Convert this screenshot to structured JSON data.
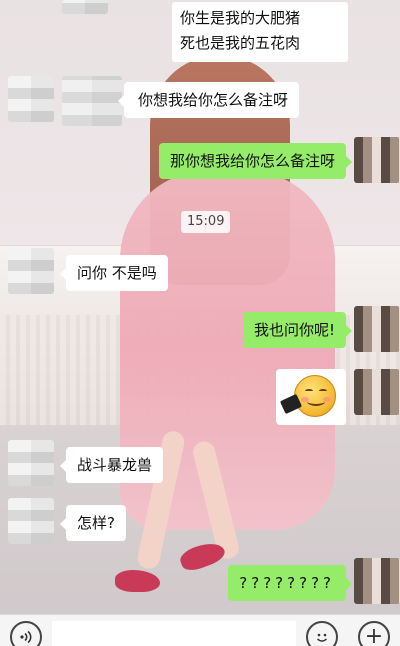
{
  "top_card": {
    "line1": "你生是我的大肥猪",
    "line2": "死也是我的五花肉"
  },
  "messages": [
    {
      "side": "left",
      "text": "你想我给你怎么备注呀"
    },
    {
      "side": "right",
      "text": "那你想我给你怎么备注呀"
    },
    {
      "side": "left",
      "text": "问你 不是吗"
    },
    {
      "side": "right",
      "text": "我也问你呢!"
    },
    {
      "side": "right",
      "emoji": "smiley-sticker"
    },
    {
      "side": "left",
      "text": "战斗暴龙兽"
    },
    {
      "side": "left",
      "text": "怎样?"
    },
    {
      "side": "right",
      "text": "????????"
    }
  ],
  "timestamp": "15:09",
  "bottom_bar": {
    "voice_icon": "voice-icon",
    "emoji_icon": "emoji-face-icon",
    "plus_icon": "plus-icon",
    "plus_symbol": "+"
  },
  "colors": {
    "incoming_bubble": "#ffffff",
    "outgoing_bubble": "#95ec69",
    "bar": "#f5f5f5"
  }
}
